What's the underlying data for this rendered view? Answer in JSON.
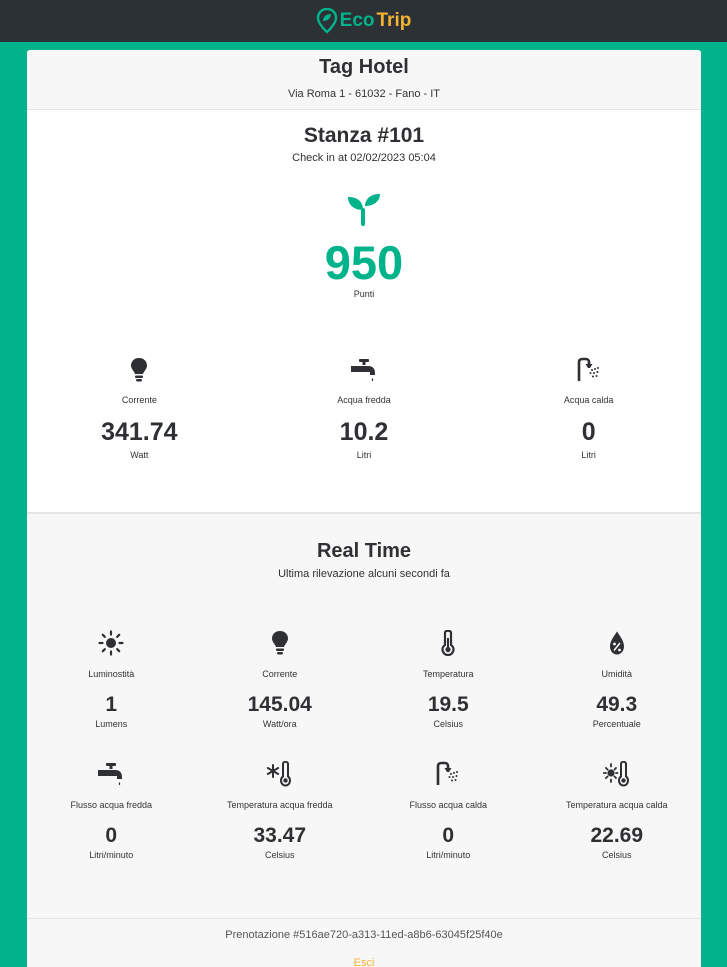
{
  "brand": {
    "eco": "Eco",
    "trip": "Trip",
    "icon": "location-leaf-icon",
    "eco_color": "#00b38a",
    "trip_color": "#f4b233"
  },
  "hotel": {
    "name": "Tag Hotel",
    "address": "Via Roma 1 - 61032 - Fano - IT"
  },
  "room": {
    "title": "Stanza #101",
    "checkin": "Check in at 02/02/2023 05:04",
    "points": "950",
    "points_label": "Punti",
    "stats": [
      {
        "icon": "lightbulb-icon",
        "label": "Corrente",
        "value": "341.74",
        "unit": "Watt"
      },
      {
        "icon": "faucet-icon",
        "label": "Acqua fredda",
        "value": "10.2",
        "unit": "Litri"
      },
      {
        "icon": "shower-icon",
        "label": "Acqua calda",
        "value": "0",
        "unit": "Litri"
      }
    ]
  },
  "realtime": {
    "title": "Real Time",
    "subtitle": "Ultima rilevazione alcuni secondi fa",
    "items": [
      {
        "icon": "sun-icon",
        "label": "Luminostità",
        "value": "1",
        "unit": "Lumens"
      },
      {
        "icon": "lightbulb-icon",
        "label": "Corrente",
        "value": "145.04",
        "unit": "Watt/ora"
      },
      {
        "icon": "thermometer-icon",
        "label": "Temperatura",
        "value": "19.5",
        "unit": "Celsius"
      },
      {
        "icon": "humidity-drop-icon",
        "label": "Umidità",
        "value": "49.3",
        "unit": "Percentuale"
      },
      {
        "icon": "faucet-icon",
        "label": "Flusso acqua fredda",
        "value": "0",
        "unit": "Litri/minuto"
      },
      {
        "icon": "snowflake-thermometer-icon",
        "label": "Temperatura acqua fredda",
        "value": "33.47",
        "unit": "Celsius"
      },
      {
        "icon": "shower-icon",
        "label": "Flusso acqua calda",
        "value": "0",
        "unit": "Litri/minuto"
      },
      {
        "icon": "sun-thermometer-icon",
        "label": "Temperatura acqua calda",
        "value": "22.69",
        "unit": "Celsius"
      }
    ]
  },
  "footer": {
    "booking": "Prenotazione #516ae720-a313-11ed-a8b6-63045f25f40e",
    "logout": "Esci"
  }
}
